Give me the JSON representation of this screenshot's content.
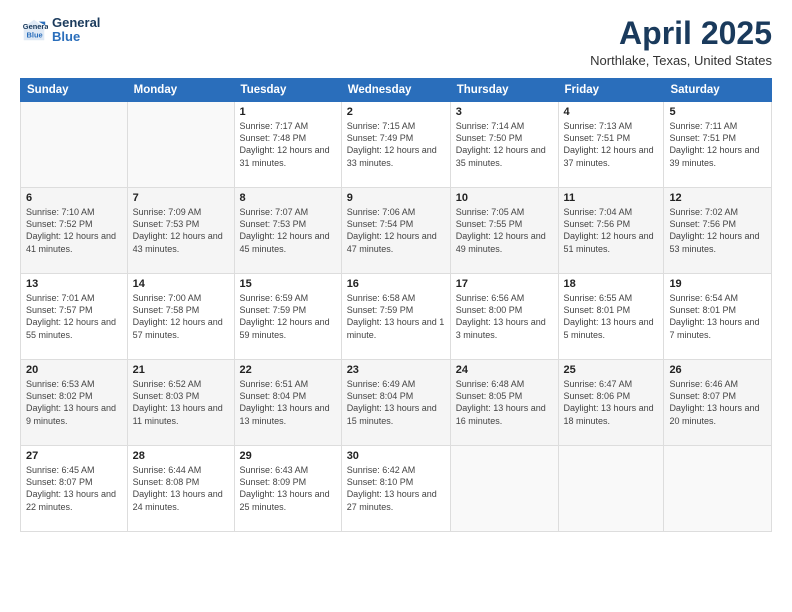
{
  "logo": {
    "line1": "General",
    "line2": "Blue"
  },
  "title": "April 2025",
  "location": "Northlake, Texas, United States",
  "weekdays": [
    "Sunday",
    "Monday",
    "Tuesday",
    "Wednesday",
    "Thursday",
    "Friday",
    "Saturday"
  ],
  "weeks": [
    [
      {
        "day": "",
        "sunrise": "",
        "sunset": "",
        "daylight": ""
      },
      {
        "day": "",
        "sunrise": "",
        "sunset": "",
        "daylight": ""
      },
      {
        "day": "1",
        "sunrise": "Sunrise: 7:17 AM",
        "sunset": "Sunset: 7:48 PM",
        "daylight": "Daylight: 12 hours and 31 minutes."
      },
      {
        "day": "2",
        "sunrise": "Sunrise: 7:15 AM",
        "sunset": "Sunset: 7:49 PM",
        "daylight": "Daylight: 12 hours and 33 minutes."
      },
      {
        "day": "3",
        "sunrise": "Sunrise: 7:14 AM",
        "sunset": "Sunset: 7:50 PM",
        "daylight": "Daylight: 12 hours and 35 minutes."
      },
      {
        "day": "4",
        "sunrise": "Sunrise: 7:13 AM",
        "sunset": "Sunset: 7:51 PM",
        "daylight": "Daylight: 12 hours and 37 minutes."
      },
      {
        "day": "5",
        "sunrise": "Sunrise: 7:11 AM",
        "sunset": "Sunset: 7:51 PM",
        "daylight": "Daylight: 12 hours and 39 minutes."
      }
    ],
    [
      {
        "day": "6",
        "sunrise": "Sunrise: 7:10 AM",
        "sunset": "Sunset: 7:52 PM",
        "daylight": "Daylight: 12 hours and 41 minutes."
      },
      {
        "day": "7",
        "sunrise": "Sunrise: 7:09 AM",
        "sunset": "Sunset: 7:53 PM",
        "daylight": "Daylight: 12 hours and 43 minutes."
      },
      {
        "day": "8",
        "sunrise": "Sunrise: 7:07 AM",
        "sunset": "Sunset: 7:53 PM",
        "daylight": "Daylight: 12 hours and 45 minutes."
      },
      {
        "day": "9",
        "sunrise": "Sunrise: 7:06 AM",
        "sunset": "Sunset: 7:54 PM",
        "daylight": "Daylight: 12 hours and 47 minutes."
      },
      {
        "day": "10",
        "sunrise": "Sunrise: 7:05 AM",
        "sunset": "Sunset: 7:55 PM",
        "daylight": "Daylight: 12 hours and 49 minutes."
      },
      {
        "day": "11",
        "sunrise": "Sunrise: 7:04 AM",
        "sunset": "Sunset: 7:56 PM",
        "daylight": "Daylight: 12 hours and 51 minutes."
      },
      {
        "day": "12",
        "sunrise": "Sunrise: 7:02 AM",
        "sunset": "Sunset: 7:56 PM",
        "daylight": "Daylight: 12 hours and 53 minutes."
      }
    ],
    [
      {
        "day": "13",
        "sunrise": "Sunrise: 7:01 AM",
        "sunset": "Sunset: 7:57 PM",
        "daylight": "Daylight: 12 hours and 55 minutes."
      },
      {
        "day": "14",
        "sunrise": "Sunrise: 7:00 AM",
        "sunset": "Sunset: 7:58 PM",
        "daylight": "Daylight: 12 hours and 57 minutes."
      },
      {
        "day": "15",
        "sunrise": "Sunrise: 6:59 AM",
        "sunset": "Sunset: 7:59 PM",
        "daylight": "Daylight: 12 hours and 59 minutes."
      },
      {
        "day": "16",
        "sunrise": "Sunrise: 6:58 AM",
        "sunset": "Sunset: 7:59 PM",
        "daylight": "Daylight: 13 hours and 1 minute."
      },
      {
        "day": "17",
        "sunrise": "Sunrise: 6:56 AM",
        "sunset": "Sunset: 8:00 PM",
        "daylight": "Daylight: 13 hours and 3 minutes."
      },
      {
        "day": "18",
        "sunrise": "Sunrise: 6:55 AM",
        "sunset": "Sunset: 8:01 PM",
        "daylight": "Daylight: 13 hours and 5 minutes."
      },
      {
        "day": "19",
        "sunrise": "Sunrise: 6:54 AM",
        "sunset": "Sunset: 8:01 PM",
        "daylight": "Daylight: 13 hours and 7 minutes."
      }
    ],
    [
      {
        "day": "20",
        "sunrise": "Sunrise: 6:53 AM",
        "sunset": "Sunset: 8:02 PM",
        "daylight": "Daylight: 13 hours and 9 minutes."
      },
      {
        "day": "21",
        "sunrise": "Sunrise: 6:52 AM",
        "sunset": "Sunset: 8:03 PM",
        "daylight": "Daylight: 13 hours and 11 minutes."
      },
      {
        "day": "22",
        "sunrise": "Sunrise: 6:51 AM",
        "sunset": "Sunset: 8:04 PM",
        "daylight": "Daylight: 13 hours and 13 minutes."
      },
      {
        "day": "23",
        "sunrise": "Sunrise: 6:49 AM",
        "sunset": "Sunset: 8:04 PM",
        "daylight": "Daylight: 13 hours and 15 minutes."
      },
      {
        "day": "24",
        "sunrise": "Sunrise: 6:48 AM",
        "sunset": "Sunset: 8:05 PM",
        "daylight": "Daylight: 13 hours and 16 minutes."
      },
      {
        "day": "25",
        "sunrise": "Sunrise: 6:47 AM",
        "sunset": "Sunset: 8:06 PM",
        "daylight": "Daylight: 13 hours and 18 minutes."
      },
      {
        "day": "26",
        "sunrise": "Sunrise: 6:46 AM",
        "sunset": "Sunset: 8:07 PM",
        "daylight": "Daylight: 13 hours and 20 minutes."
      }
    ],
    [
      {
        "day": "27",
        "sunrise": "Sunrise: 6:45 AM",
        "sunset": "Sunset: 8:07 PM",
        "daylight": "Daylight: 13 hours and 22 minutes."
      },
      {
        "day": "28",
        "sunrise": "Sunrise: 6:44 AM",
        "sunset": "Sunset: 8:08 PM",
        "daylight": "Daylight: 13 hours and 24 minutes."
      },
      {
        "day": "29",
        "sunrise": "Sunrise: 6:43 AM",
        "sunset": "Sunset: 8:09 PM",
        "daylight": "Daylight: 13 hours and 25 minutes."
      },
      {
        "day": "30",
        "sunrise": "Sunrise: 6:42 AM",
        "sunset": "Sunset: 8:10 PM",
        "daylight": "Daylight: 13 hours and 27 minutes."
      },
      {
        "day": "",
        "sunrise": "",
        "sunset": "",
        "daylight": ""
      },
      {
        "day": "",
        "sunrise": "",
        "sunset": "",
        "daylight": ""
      },
      {
        "day": "",
        "sunrise": "",
        "sunset": "",
        "daylight": ""
      }
    ]
  ]
}
